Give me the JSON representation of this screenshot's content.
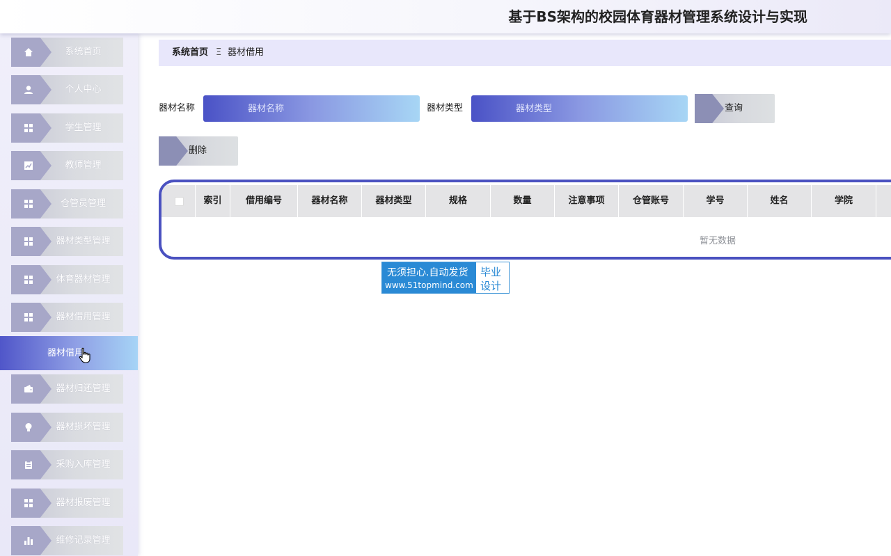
{
  "header": {
    "title": "基于BS架构的校园体育器材管理系统设计与实现"
  },
  "sidebar": {
    "items": [
      {
        "label": "系统首页",
        "icon": "home-icon"
      },
      {
        "label": "个人中心",
        "icon": "user-icon"
      },
      {
        "label": "学生管理",
        "icon": "grid-icon"
      },
      {
        "label": "教师管理",
        "icon": "chart-line-icon"
      },
      {
        "label": "仓管员管理",
        "icon": "grid-icon"
      },
      {
        "label": "器材类型管理",
        "icon": "grid-icon"
      },
      {
        "label": "体育器材管理",
        "icon": "grid-icon"
      },
      {
        "label": "器材借用管理",
        "icon": "grid-icon"
      },
      {
        "label": "器材归还管理",
        "icon": "wallet-icon"
      },
      {
        "label": "器材损坏管理",
        "icon": "bulb-icon"
      },
      {
        "label": "采购入库管理",
        "icon": "clipboard-icon"
      },
      {
        "label": "器材报废管理",
        "icon": "grid-icon"
      },
      {
        "label": "维修记录管理",
        "icon": "bar-chart-icon"
      }
    ],
    "active_sub_item": "器材借用"
  },
  "breadcrumb": {
    "home": "系统首页",
    "separator": "Ξ",
    "current": "器材借用"
  },
  "search": {
    "name_label": "器材名称",
    "name_placeholder": "器材名称",
    "type_label": "器材类型",
    "type_placeholder": "器材类型",
    "query_button": "查询"
  },
  "actions": {
    "delete_button": "删除"
  },
  "table": {
    "columns": [
      "索引",
      "借用编号",
      "器材名称",
      "器材类型",
      "规格",
      "数量",
      "注意事项",
      "仓管账号",
      "学号",
      "姓名",
      "学院"
    ],
    "rows": [],
    "empty_text": "暂无数据"
  },
  "watermark": {
    "line1": "无须担心.自动发货",
    "line2": "www.51topmind.com",
    "right1": "毕业",
    "right2": "设计"
  },
  "colors": {
    "accent": "#4a51c0",
    "gradient_start": "#4a52c6",
    "gradient_end": "#a7d6f5"
  }
}
